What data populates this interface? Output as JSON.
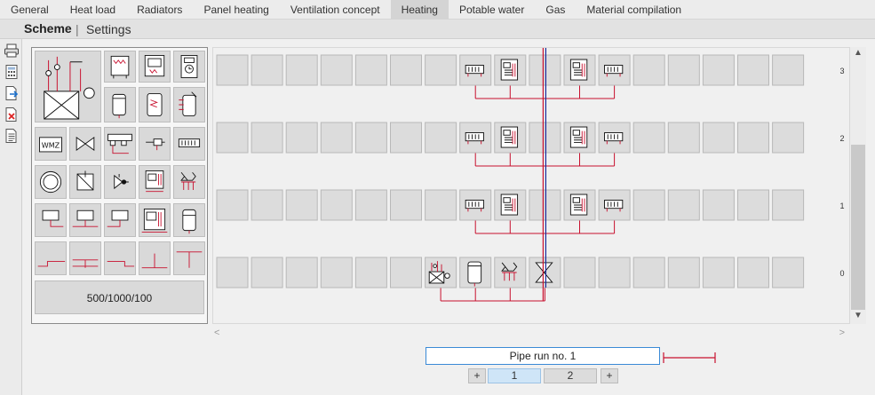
{
  "tabs": [
    "General",
    "Heat load",
    "Radiators",
    "Panel heating",
    "Ventilation concept",
    "Heating",
    "Potable water",
    "Gas",
    "Material compilation"
  ],
  "active_tab_index": 5,
  "subheader": {
    "title": "Scheme",
    "separator": "|",
    "settings_label": "Settings"
  },
  "left_toolbar": {
    "icons": [
      "printer-icon",
      "calculator-icon",
      "export-icon",
      "delete-file-icon",
      "document-icon"
    ]
  },
  "palette": {
    "dimensions_button": "500/1000/100",
    "items": [
      "heat-generator-schematic-icon",
      "boiler-wall-icon",
      "gas-boiler-icon",
      "control-unit-icon",
      "storage-tank-icon",
      "storage-tank-coil-icon",
      "solar-storage-icon",
      "heat-meter-icon",
      "valve-icon",
      "distributor-icon",
      "pump-valve-icon",
      "radiator-valve-icon",
      "circular-tank-icon",
      "mixing-valve-icon",
      "three-way-valve-icon",
      "boiler-pump-icon",
      "manifold-icon",
      "radiator-left-icon",
      "radiator-center-icon",
      "radiator-right-icon",
      "floor-boiler-icon",
      "buffer-tank-icon",
      "tee-left-icon",
      "tee-both-icon",
      "tee-right-icon",
      "tee-up-icon",
      "tee-down-icon"
    ],
    "heat_meter_label": "WMZ"
  },
  "scheme": {
    "floor_labels": [
      "3",
      "2",
      "1",
      "0"
    ],
    "floors": [
      {
        "level": "3",
        "components": {
          "7": "radiator-icon",
          "8": "boiler-icon",
          "10": "boiler-icon",
          "11": "radiator-icon"
        }
      },
      {
        "level": "2",
        "components": {
          "7": "radiator-icon",
          "8": "boiler-icon",
          "10": "boiler-icon",
          "11": "radiator-icon"
        }
      },
      {
        "level": "1",
        "components": {
          "7": "radiator-icon",
          "8": "boiler-icon",
          "10": "boiler-icon",
          "11": "radiator-icon"
        }
      },
      {
        "level": "0",
        "components": {
          "6": "heat-generator-icon",
          "7": "storage-tank-icon",
          "8": "manifold-icon",
          "9": "valve-icon"
        }
      }
    ],
    "pipe_color": "#c8102e",
    "riser_colors": [
      "#c8102e",
      "#1a2a9a"
    ]
  },
  "pipe_run": {
    "label": "Pipe run no. 1",
    "pages": [
      "1",
      "2"
    ],
    "active_page": "1",
    "add_symbol": "+"
  },
  "scroll": {
    "up": "▲",
    "down": "▼",
    "left": "<",
    "right": ">"
  }
}
